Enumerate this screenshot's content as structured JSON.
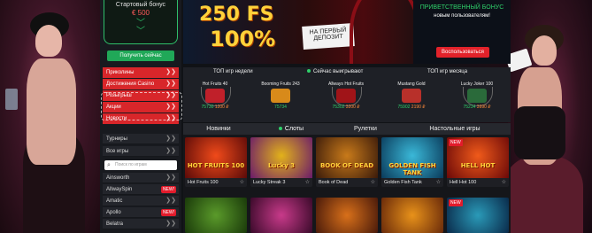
{
  "sidebar": {
    "bonus_title": "Стартовый бонус",
    "bonus_amount": "€ 500",
    "get_button": "Получить сейчас",
    "red_items": [
      {
        "label": "Приколины"
      },
      {
        "label": "Достижения Casino"
      },
      {
        "label": "Розыгрыш"
      },
      {
        "label": "Акции"
      },
      {
        "label": "Новости"
      }
    ],
    "dark_items": [
      {
        "label": "Турниры"
      },
      {
        "label": "Все игры"
      }
    ],
    "search_placeholder": "Поиск по играм",
    "providers": [
      {
        "label": "Ainsworth",
        "badge": ""
      },
      {
        "label": "AllwaySpin",
        "badge": "NEW!"
      },
      {
        "label": "Amatic",
        "badge": ""
      },
      {
        "label": "Apollo",
        "badge": "NEW!"
      },
      {
        "label": "Belatra",
        "badge": ""
      }
    ]
  },
  "banner": {
    "fs_text": "250 FS",
    "pct_text": "100%",
    "first_deposit": "НА ПЕРВЫЙ ДЕПОЗИТ",
    "promo_title": "ПРИВЕТСТВЕННЫЙ БОНУС",
    "promo_sub": "новым пользователям!",
    "promo_button": "Воспользоваться"
  },
  "top_row": {
    "headers": {
      "week": "ТОП игр недели",
      "live": "Сейчас выигрывают",
      "month": "ТОП игр месяца"
    },
    "winners": [
      {
        "name": "Hot Fruits 40",
        "amount": "75730",
        "amount2": "1200 ₽"
      },
      {
        "name": "Booming Fruits 243",
        "amount": "75734",
        "amount2": ""
      },
      {
        "name": "Allways Hot Fruits",
        "amount": "75302",
        "amount2": "3200 ₽"
      },
      {
        "name": "Mustang Gold",
        "amount": "75902",
        "amount2": "2190 ₽"
      },
      {
        "name": "Lucky Joker 100",
        "amount": "75234",
        "amount2": "3990 ₽"
      }
    ]
  },
  "tabs": [
    {
      "label": "Новинки"
    },
    {
      "label": "Слоты"
    },
    {
      "label": "Рулетки"
    },
    {
      "label": "Настольные игры"
    }
  ],
  "games": [
    {
      "caption": "Hot Fruits 100",
      "art_label": "HOT FRUITS 100",
      "badge": ""
    },
    {
      "caption": "Lucky Streak 3",
      "art_label": "Lucky 3",
      "badge": ""
    },
    {
      "caption": "Book of Dead",
      "art_label": "BOOK OF DEAD",
      "badge": ""
    },
    {
      "caption": "Golden Fish Tank",
      "art_label": "GOLDEN FISH TANK",
      "badge": ""
    },
    {
      "caption": "Hell Hot 100",
      "art_label": "HELL HOT",
      "badge": "NEW"
    }
  ],
  "games_row2": [
    {
      "badge": ""
    },
    {
      "badge": ""
    },
    {
      "badge": ""
    },
    {
      "badge": ""
    },
    {
      "badge": "NEW"
    }
  ],
  "colors": {
    "accent_red": "#d8262a",
    "accent_green": "#2fbf6a",
    "gold": "#ffd23a"
  }
}
